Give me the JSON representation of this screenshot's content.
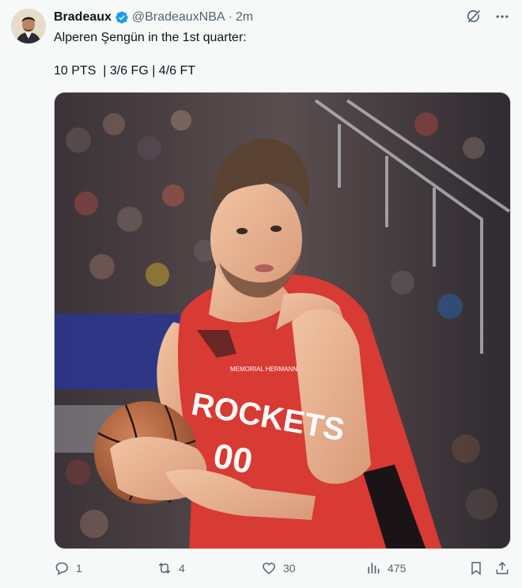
{
  "tweet": {
    "author": {
      "name": "Bradeaux",
      "handle": "@BradeauxNBA",
      "separator": "·",
      "time": "2m",
      "verified_color": "#1d9bf0"
    },
    "text_line1": "Alperen Şengün in the 1st quarter:",
    "text_line2": "10 PTS  | 3/6 FG | 4/6 FT",
    "media": {
      "jersey_text": "ROCKETS",
      "jersey_number": "00",
      "jersey_patch": "MEMORIAL HERMANN",
      "jersey_color": "#d83a34"
    },
    "icons": {
      "top": [
        "grok-icon",
        "more-icon"
      ],
      "actions": [
        "reply-icon",
        "retweet-icon",
        "like-icon",
        "views-icon",
        "bookmark-icon",
        "share-icon"
      ]
    },
    "actions": {
      "replies": "1",
      "retweets": "4",
      "likes": "30",
      "views": "475"
    }
  }
}
